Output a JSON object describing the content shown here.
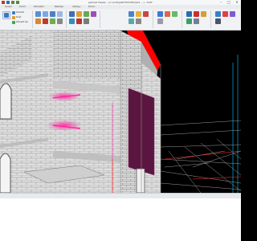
{
  "window": {
    "title": "JabCAD Master - [C:\\CAD\\JAB\\TEST\\PROJ\\01 ...] - SVAT"
  },
  "window_controls": {
    "minimize": "–",
    "maximize": "□",
    "close": "✕"
  },
  "tabs": [
    "Soubor",
    "Domů",
    "Zobrazení",
    "Nástroje",
    "Výstupy",
    "Pomoc"
  ],
  "ribbon": {
    "items": [
      "Zobrazit",
      "Skrýt",
      "Zobrazit vše",
      "Režim"
    ],
    "groups": [
      "Vrstvy",
      "Pohled",
      "Nástroje",
      "Zobrazení"
    ]
  },
  "status": {
    "text": ""
  },
  "colors": {
    "accent": "#ff0000",
    "magenta": "#ff2aa0",
    "brick": "#dcdcdc",
    "dark_purple": "#5a1640"
  },
  "icons": [
    "app-icon",
    "save-icon",
    "undo-icon",
    "redo-icon",
    "minimize-icon",
    "maximize-icon",
    "close-icon"
  ]
}
